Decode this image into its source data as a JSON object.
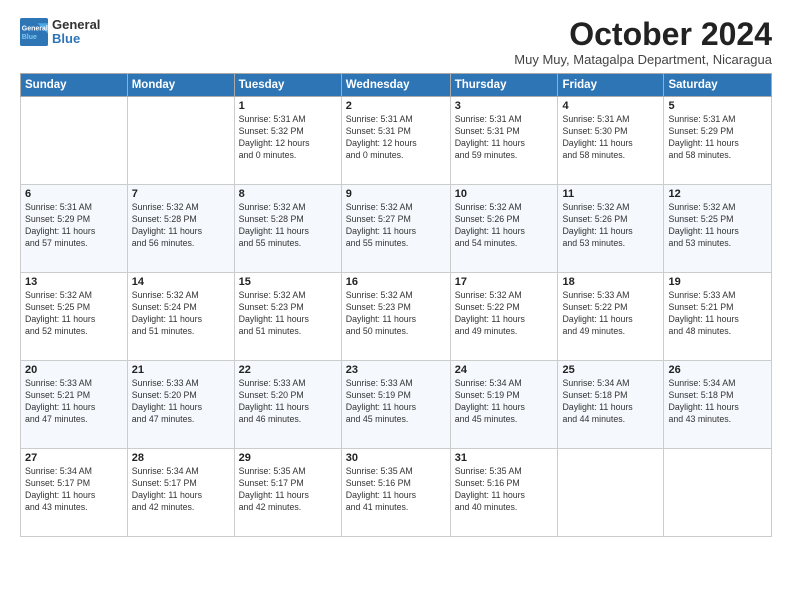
{
  "logo": {
    "line1": "General",
    "line2": "Blue"
  },
  "title": "October 2024",
  "location": "Muy Muy, Matagalpa Department, Nicaragua",
  "days_of_week": [
    "Sunday",
    "Monday",
    "Tuesday",
    "Wednesday",
    "Thursday",
    "Friday",
    "Saturday"
  ],
  "weeks": [
    [
      {
        "day": "",
        "info": ""
      },
      {
        "day": "",
        "info": ""
      },
      {
        "day": "1",
        "info": "Sunrise: 5:31 AM\nSunset: 5:32 PM\nDaylight: 12 hours\nand 0 minutes."
      },
      {
        "day": "2",
        "info": "Sunrise: 5:31 AM\nSunset: 5:31 PM\nDaylight: 12 hours\nand 0 minutes."
      },
      {
        "day": "3",
        "info": "Sunrise: 5:31 AM\nSunset: 5:31 PM\nDaylight: 11 hours\nand 59 minutes."
      },
      {
        "day": "4",
        "info": "Sunrise: 5:31 AM\nSunset: 5:30 PM\nDaylight: 11 hours\nand 58 minutes."
      },
      {
        "day": "5",
        "info": "Sunrise: 5:31 AM\nSunset: 5:29 PM\nDaylight: 11 hours\nand 58 minutes."
      }
    ],
    [
      {
        "day": "6",
        "info": "Sunrise: 5:31 AM\nSunset: 5:29 PM\nDaylight: 11 hours\nand 57 minutes."
      },
      {
        "day": "7",
        "info": "Sunrise: 5:32 AM\nSunset: 5:28 PM\nDaylight: 11 hours\nand 56 minutes."
      },
      {
        "day": "8",
        "info": "Sunrise: 5:32 AM\nSunset: 5:28 PM\nDaylight: 11 hours\nand 55 minutes."
      },
      {
        "day": "9",
        "info": "Sunrise: 5:32 AM\nSunset: 5:27 PM\nDaylight: 11 hours\nand 55 minutes."
      },
      {
        "day": "10",
        "info": "Sunrise: 5:32 AM\nSunset: 5:26 PM\nDaylight: 11 hours\nand 54 minutes."
      },
      {
        "day": "11",
        "info": "Sunrise: 5:32 AM\nSunset: 5:26 PM\nDaylight: 11 hours\nand 53 minutes."
      },
      {
        "day": "12",
        "info": "Sunrise: 5:32 AM\nSunset: 5:25 PM\nDaylight: 11 hours\nand 53 minutes."
      }
    ],
    [
      {
        "day": "13",
        "info": "Sunrise: 5:32 AM\nSunset: 5:25 PM\nDaylight: 11 hours\nand 52 minutes."
      },
      {
        "day": "14",
        "info": "Sunrise: 5:32 AM\nSunset: 5:24 PM\nDaylight: 11 hours\nand 51 minutes."
      },
      {
        "day": "15",
        "info": "Sunrise: 5:32 AM\nSunset: 5:23 PM\nDaylight: 11 hours\nand 51 minutes."
      },
      {
        "day": "16",
        "info": "Sunrise: 5:32 AM\nSunset: 5:23 PM\nDaylight: 11 hours\nand 50 minutes."
      },
      {
        "day": "17",
        "info": "Sunrise: 5:32 AM\nSunset: 5:22 PM\nDaylight: 11 hours\nand 49 minutes."
      },
      {
        "day": "18",
        "info": "Sunrise: 5:33 AM\nSunset: 5:22 PM\nDaylight: 11 hours\nand 49 minutes."
      },
      {
        "day": "19",
        "info": "Sunrise: 5:33 AM\nSunset: 5:21 PM\nDaylight: 11 hours\nand 48 minutes."
      }
    ],
    [
      {
        "day": "20",
        "info": "Sunrise: 5:33 AM\nSunset: 5:21 PM\nDaylight: 11 hours\nand 47 minutes."
      },
      {
        "day": "21",
        "info": "Sunrise: 5:33 AM\nSunset: 5:20 PM\nDaylight: 11 hours\nand 47 minutes."
      },
      {
        "day": "22",
        "info": "Sunrise: 5:33 AM\nSunset: 5:20 PM\nDaylight: 11 hours\nand 46 minutes."
      },
      {
        "day": "23",
        "info": "Sunrise: 5:33 AM\nSunset: 5:19 PM\nDaylight: 11 hours\nand 45 minutes."
      },
      {
        "day": "24",
        "info": "Sunrise: 5:34 AM\nSunset: 5:19 PM\nDaylight: 11 hours\nand 45 minutes."
      },
      {
        "day": "25",
        "info": "Sunrise: 5:34 AM\nSunset: 5:18 PM\nDaylight: 11 hours\nand 44 minutes."
      },
      {
        "day": "26",
        "info": "Sunrise: 5:34 AM\nSunset: 5:18 PM\nDaylight: 11 hours\nand 43 minutes."
      }
    ],
    [
      {
        "day": "27",
        "info": "Sunrise: 5:34 AM\nSunset: 5:17 PM\nDaylight: 11 hours\nand 43 minutes."
      },
      {
        "day": "28",
        "info": "Sunrise: 5:34 AM\nSunset: 5:17 PM\nDaylight: 11 hours\nand 42 minutes."
      },
      {
        "day": "29",
        "info": "Sunrise: 5:35 AM\nSunset: 5:17 PM\nDaylight: 11 hours\nand 42 minutes."
      },
      {
        "day": "30",
        "info": "Sunrise: 5:35 AM\nSunset: 5:16 PM\nDaylight: 11 hours\nand 41 minutes."
      },
      {
        "day": "31",
        "info": "Sunrise: 5:35 AM\nSunset: 5:16 PM\nDaylight: 11 hours\nand 40 minutes."
      },
      {
        "day": "",
        "info": ""
      },
      {
        "day": "",
        "info": ""
      }
    ]
  ]
}
